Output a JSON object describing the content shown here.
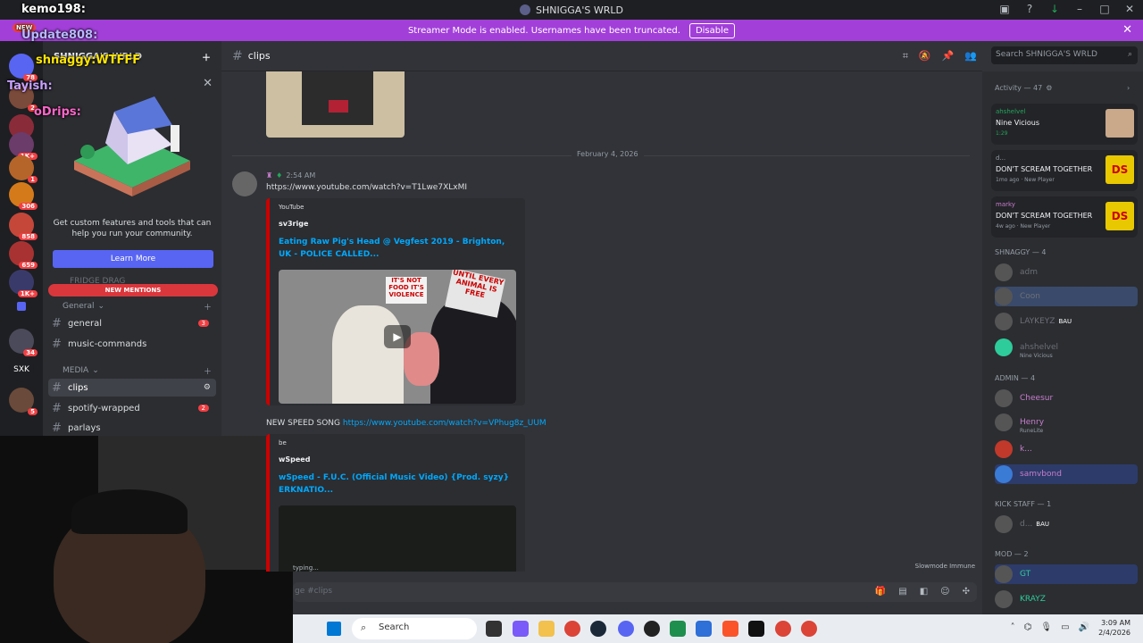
{
  "window": {
    "title": "SHNIGGA'S WRLD"
  },
  "banner": {
    "text": "Streamer Mode is enabled. Usernames have been truncated.",
    "button": "Disable"
  },
  "stream_overlay": {
    "lines": [
      "kemo198:",
      "NEW",
      "Update808:",
      "shnaggy:WTFFF",
      "Tayish:",
      "oDrips:"
    ]
  },
  "server_list": {
    "badges": [
      "78",
      "2",
      "1K+",
      "1",
      "306",
      "858",
      "659",
      "1K+",
      "34",
      "5"
    ],
    "label": "SXK"
  },
  "sidebar": {
    "server_name": "SHNIGGA'S WRLD",
    "promo": {
      "text": "Get custom features and tools that can help you run your community.",
      "button": "Learn More"
    },
    "hidden_channel": "FRIDGE DRAG",
    "new_mentions": "NEW MENTIONS",
    "categories": [
      {
        "name": "General",
        "channels": [
          {
            "name": "general",
            "count": "3"
          },
          {
            "name": "music-commands",
            "count": ""
          }
        ]
      },
      {
        "name": "MEDIA",
        "channels": [
          {
            "name": "clips",
            "count": ""
          },
          {
            "name": "spotify-wrapped",
            "count": "2"
          },
          {
            "name": "parlays",
            "count": ""
          }
        ]
      }
    ]
  },
  "channel": {
    "name": "clips",
    "search_placeholder": "Search SHNIGGA'S WRLD"
  },
  "messages": {
    "date_divider": "February 4, 2026",
    "time": "2:54 AM",
    "link1": "https://www.youtube.com/watch?v=T1Lwe7XLxMI",
    "embed1": {
      "provider": "YouTube",
      "author": "sv3rige",
      "title": "Eating Raw Pig's Head @ Vegfest 2019 - Brighton, UK - POLICE CALLED...",
      "sign1": "IT'S NOT FOOD IT'S VIOLENCE",
      "sign2": "UNTIL EVERY ANIMAL IS FREE"
    },
    "msg2_text": "NEW SPEED SONG",
    "link2": "https://www.youtube.com/watch?v=VPhug8z_UUM",
    "embed2": {
      "provider": "be",
      "author": "wSpeed",
      "title": "wSpeed - F.U.C. (Official Music Video) {Prod. syzy} ERKNATIO..."
    },
    "typing": "typing...",
    "slowmode": "Slowmode Immune",
    "input_placeholder": "ge #clips"
  },
  "members": {
    "activity_header": "Activity — 47",
    "activities": [
      {
        "user": "ahshelvel",
        "title": "Nine Vicious",
        "sub": "1:29",
        "art_color": "#c9a98a"
      },
      {
        "user": "d...",
        "title": "DON'T SCREAM TOGETHER",
        "sub": "1mo ago",
        "sub2": "New Player",
        "art_color": "#e8c800"
      },
      {
        "user": "marky",
        "title": "DON'T SCREAM TOGETHER",
        "sub": "4w ago",
        "sub2": "New Player",
        "art_color": "#e8c800"
      }
    ],
    "groups": [
      {
        "name": "SHNAGGY — 4",
        "members": [
          {
            "name": "adm",
            "status": "",
            "color": "#949ba4"
          },
          {
            "name": "Coon",
            "status": "",
            "color": "#949ba4"
          },
          {
            "name": "LAYKEYZ",
            "status": "",
            "color": "#949ba4",
            "tag": "BAU"
          },
          {
            "name": "ahshelvel",
            "status": "Nine Vicious",
            "color": "#949ba4"
          }
        ]
      },
      {
        "name": "ADMIN — 4",
        "members": [
          {
            "name": "Cheesur",
            "status": "",
            "color": "#c77dcc"
          },
          {
            "name": "Henry",
            "status": "RuneLite",
            "color": "#c77dcc"
          },
          {
            "name": "k...",
            "status": "",
            "color": "#c77dcc"
          },
          {
            "name": "samvbond",
            "status": "",
            "color": "#c77dcc"
          }
        ]
      },
      {
        "name": "KICK STAFF — 1",
        "members": [
          {
            "name": "d...",
            "status": "",
            "color": "#949ba4",
            "tag": "BAU"
          }
        ]
      },
      {
        "name": "MOD — 2",
        "members": [
          {
            "name": "GT",
            "status": "",
            "color": "#2ecc9a"
          },
          {
            "name": "KRAYZ",
            "status": "",
            "color": "#2ecc9a"
          }
        ]
      }
    ]
  },
  "taskbar": {
    "search": "Search",
    "time": "3:09 AM",
    "date": "2/4/2026"
  }
}
